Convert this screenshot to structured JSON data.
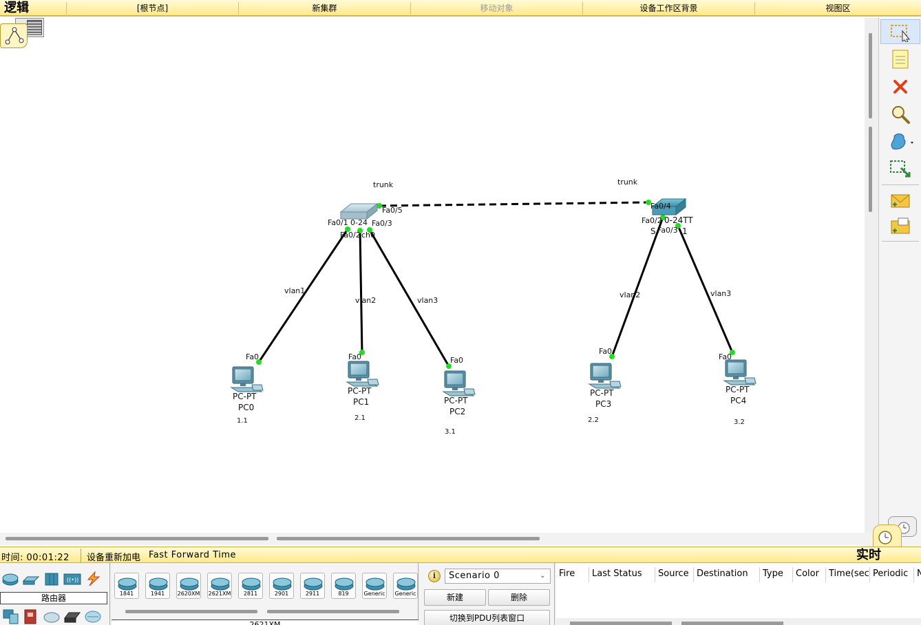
{
  "toolbar": {
    "mode": "逻辑",
    "root": "[根节点]",
    "new_cluster": "新集群",
    "move_object": "移动对象",
    "workspace_background": "设备工作区背景",
    "viewport": "视图区"
  },
  "topology": {
    "switches": [
      {
        "id": "sw0",
        "label": "Fa0/1 ... 24 ... ch0",
        "visible_text": [
          "Fa0/1",
          "0-24",
          "ch0"
        ]
      },
      {
        "id": "sw1",
        "visible_text": [
          "2960-24TT",
          "Switch1"
        ]
      }
    ],
    "link_labels": {
      "trunk_left": "trunk",
      "trunk_right": "trunk",
      "vlan1": "vlan1",
      "vlan2_left": "vlan2",
      "vlan3_left": "vlan3",
      "vlan2_right": "vlan2",
      "vlan3_right": "vlan3"
    },
    "port_labels": {
      "sw0_fa05": "Fa0/5",
      "sw0_fa01": "Fa0/1",
      "sw0_fa01_suffix": "0-24",
      "sw0_fa03": "Fa0/3",
      "sw0_fa02": "Fa0/2",
      "sw0_name_tail": "ch0",
      "sw1_fa04": "Fa0/4",
      "sw1_fa02": "Fa0/2",
      "sw1_model_tail": "0-24TT",
      "sw1_fa03": "Fa0/3",
      "sw1_name_head": "S",
      "sw1_name_tail": "1",
      "pc0_fa0": "Fa0",
      "pc1_fa0": "Fa0",
      "pc2_fa0": "Fa0",
      "pc3_fa0": "Fa0",
      "pc4_fa0": "Fa0"
    },
    "pcs": [
      {
        "type": "PC-PT",
        "name": "PC0",
        "ip": "1.1"
      },
      {
        "type": "PC-PT",
        "name": "PC1",
        "ip": "2.1"
      },
      {
        "type": "PC-PT",
        "name": "PC2",
        "ip": "3.1"
      },
      {
        "type": "PC-PT",
        "name": "PC3",
        "ip": "2.2"
      },
      {
        "type": "PC-PT",
        "name": "PC4",
        "ip": "3.2"
      }
    ]
  },
  "status": {
    "time": "时间: 00:01:22",
    "power_cycle": "设备重新加电",
    "fast_forward": "Fast Forward Time",
    "realtime": "实时"
  },
  "device_panel": {
    "category": "路由器",
    "models": [
      "1841",
      "1941",
      "2620XM",
      "2621XM",
      "2811",
      "2901",
      "2911",
      "819",
      "Generic",
      "Generic"
    ],
    "selected_model": "2621XM"
  },
  "scenario": {
    "selected": "Scenario 0",
    "new": "新建",
    "delete": "删除",
    "toggle_pdu": "切换到PDU列表窗口"
  },
  "pdu_table": {
    "columns": [
      "Fire",
      "Last Status",
      "Source",
      "Destination",
      "Type",
      "Color",
      "Time(sec)",
      "Periodic",
      "Num"
    ]
  },
  "colors": {
    "toolbar_bg": "#ffe98a",
    "link": "#000000",
    "port_up": "#22dd22",
    "delete_tool": "#e2401c"
  }
}
